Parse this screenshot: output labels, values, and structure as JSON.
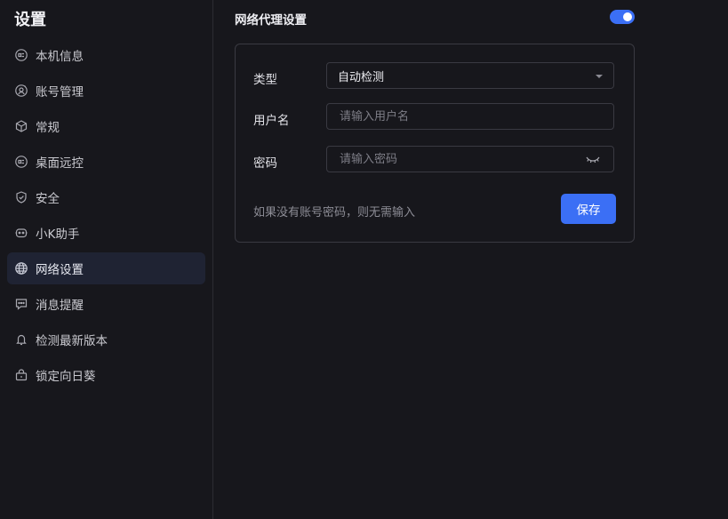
{
  "sidebar": {
    "title": "设置",
    "items": [
      {
        "label": "本机信息",
        "icon": "device-info-icon"
      },
      {
        "label": "账号管理",
        "icon": "account-icon"
      },
      {
        "label": "常规",
        "icon": "cube-icon"
      },
      {
        "label": "桌面远控",
        "icon": "remote-desktop-icon"
      },
      {
        "label": "安全",
        "icon": "shield-icon"
      },
      {
        "label": "小K助手",
        "icon": "robot-icon"
      },
      {
        "label": "网络设置",
        "icon": "globe-icon",
        "active": true
      },
      {
        "label": "消息提醒",
        "icon": "message-icon"
      },
      {
        "label": "检测最新版本",
        "icon": "bell-icon"
      },
      {
        "label": "锁定向日葵",
        "icon": "lock-icon"
      }
    ]
  },
  "proxy": {
    "title": "网络代理设置",
    "enabled": true,
    "type_label": "类型",
    "type_value": "自动检测",
    "username_label": "用户名",
    "username_placeholder": "请输入用户名",
    "password_label": "密码",
    "password_placeholder": "请输入密码",
    "hint": "如果没有账号密码，则无需输入",
    "save_label": "保存"
  },
  "colors": {
    "accent": "#3b6ff5",
    "background": "#17171c",
    "active_item": "#1f2333"
  }
}
